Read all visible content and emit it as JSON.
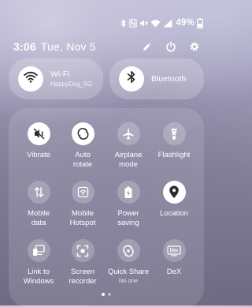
{
  "status_bar": {
    "battery": "49%",
    "icons": [
      "bluetooth-icon",
      "nfc-icon",
      "mute-icon",
      "wifi-icon",
      "signal-icon",
      "battery-icon"
    ]
  },
  "header": {
    "time": "3:06",
    "date": "Tue, Nov 5",
    "actions": [
      "edit-icon",
      "power-icon",
      "settings-icon"
    ]
  },
  "connections": {
    "wifi": {
      "title": "Wi-Fi",
      "subtitle": "HappyDog_5G",
      "active": true
    },
    "bluetooth": {
      "title": "Bluetooth",
      "active": true
    }
  },
  "tiles": [
    {
      "label": "Vibrate",
      "icon": "vibrate-icon",
      "active": true
    },
    {
      "label": "Auto\nrotate",
      "icon": "auto-rotate-icon",
      "active": true
    },
    {
      "label": "Airplane\nmode",
      "icon": "airplane-icon",
      "active": false
    },
    {
      "label": "Flashlight",
      "icon": "flashlight-icon",
      "active": false
    },
    {
      "label": "Mobile\ndata",
      "icon": "mobile-data-icon",
      "active": false
    },
    {
      "label": "Mobile\nHotspot",
      "icon": "hotspot-icon",
      "active": false
    },
    {
      "label": "Power\nsaving",
      "icon": "power-saving-icon",
      "active": false
    },
    {
      "label": "Location",
      "icon": "location-icon",
      "active": true
    },
    {
      "label": "Link to\nWindows",
      "icon": "link-to-windows-icon",
      "active": false
    },
    {
      "label": "Screen\nrecorder",
      "icon": "screen-recorder-icon",
      "active": false
    },
    {
      "label": "Quick Share",
      "sublabel": "No one",
      "icon": "quick-share-icon",
      "active": false
    },
    {
      "label": "DeX",
      "icon": "dex-icon",
      "active": false
    }
  ],
  "page_indicator": {
    "pages": 2,
    "current": 1
  },
  "colors": {
    "tile_on": "#ffffff",
    "tile_on_glyph": "#2a2a30",
    "tile_off": "rgba(255,255,255,0.22)",
    "text": "#ffffff"
  }
}
